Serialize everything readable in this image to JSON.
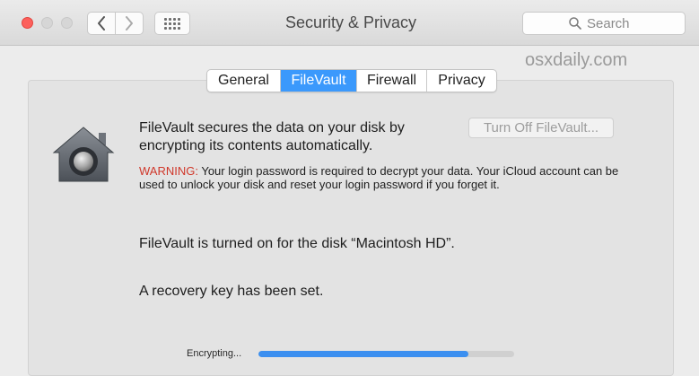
{
  "window": {
    "title": "Security & Privacy",
    "search_placeholder": "Search"
  },
  "watermark": "osxdaily.com",
  "tabs": [
    {
      "label": "General",
      "active": false
    },
    {
      "label": "FileVault",
      "active": true
    },
    {
      "label": "Firewall",
      "active": false
    },
    {
      "label": "Privacy",
      "active": false
    }
  ],
  "filevault": {
    "description": "FileVault secures the data on your disk by encrypting its contents automatically.",
    "turn_off_label": "Turn Off FileVault...",
    "warning_label": "WARNING:",
    "warning_text": " Your login password is required to decrypt your data. Your iCloud account can be used to unlock your disk and reset your login password if you forget it.",
    "status_on": "FileVault is turned on for the disk “Macintosh HD”.",
    "status_recovery": "A recovery key has been set.",
    "encrypting_label": "Encrypting...",
    "progress": 0.82
  },
  "icons": {
    "lock_house": "filevault-house-icon",
    "search": "search-icon",
    "back": "chevron-left-icon",
    "forward": "chevron-right-icon",
    "grid": "grid-icon"
  },
  "colors": {
    "accent": "#3b99fc",
    "warning": "#d0382b",
    "close_light": "#fc605c"
  }
}
